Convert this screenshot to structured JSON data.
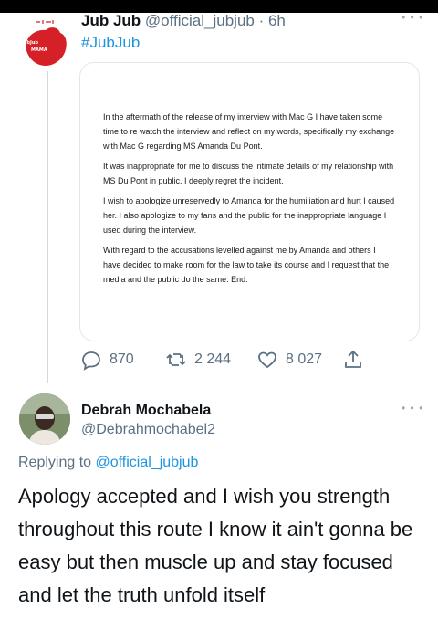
{
  "tweet": {
    "name": "Jub Jub",
    "handle_time": "@official_jubjub · 6h",
    "hashtag": "#JubJub",
    "avatar_label_top": "JubJub",
    "avatar_label_mid": "MAMA",
    "card_paragraphs": [
      "In the aftermath of the release of my interview with Mac G I have taken some time to re watch the interview and reflect on my words, specifically my exchange with Mac G regarding MS Amanda Du Pont.",
      "It was inappropriate for me to discuss the intimate details of my relationship with MS Du Pont in public. I deeply regret the incident.",
      "I wish to apologize unreservedly to Amanda for the humiliation and hurt I caused her. I also apologize to my fans and the public for the inappropriate language I used during the interview.",
      "With regard to the accusations levelled against me by Amanda and others I have decided to make room for the law to take its course and I request that the media and the public do the same. End."
    ],
    "replies": "870",
    "retweets": "2 244",
    "likes": "8 027",
    "more": "• • •"
  },
  "reply": {
    "name": "Debrah Mochabela",
    "handle": "@Debrahmochabel2",
    "replying_prefix": "Replying to",
    "replying_to": "@official_jubjub",
    "text": "Apology accepted and I wish you strength throughout this route I know it ain't gonna be easy but then muscle up and stay focused and let the truth unfold itself",
    "more": "• • •"
  },
  "colors": {
    "link": "#1b95e0",
    "muted": "#5b7083",
    "avatar_red": "#d62027"
  }
}
